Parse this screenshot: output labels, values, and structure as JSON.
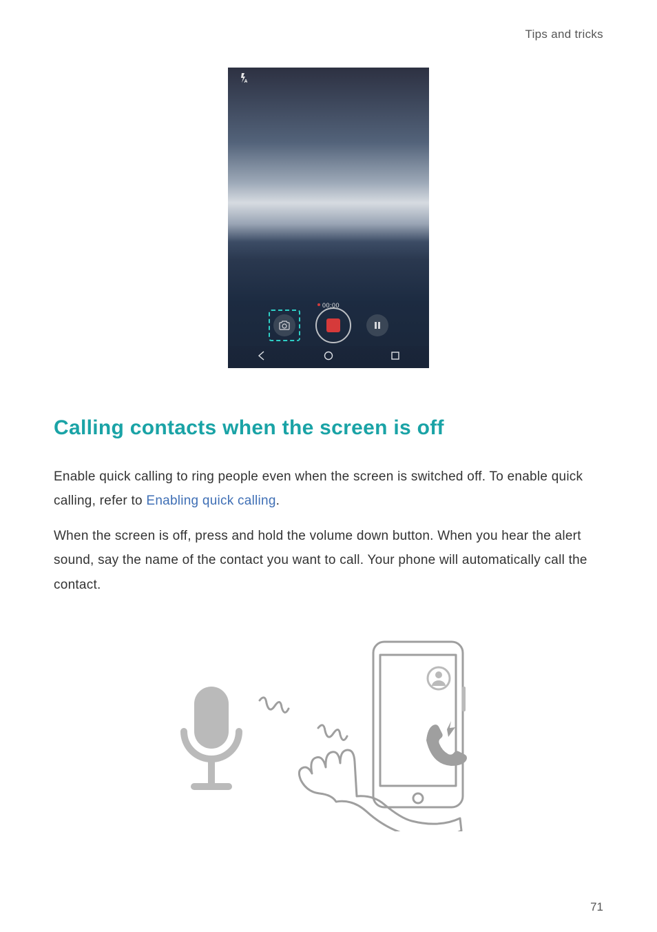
{
  "header": {
    "section_label": "Tips and tricks"
  },
  "screenshot": {
    "flash_icon_name": "flash-auto-icon",
    "recording_time": "00:00",
    "controls": {
      "camera_icon_name": "camera-icon",
      "record_icon_name": "record-button",
      "pause_icon_name": "pause-icon"
    },
    "nav": {
      "back_icon": "nav-back-icon",
      "home_icon": "nav-home-icon",
      "recents_icon": "nav-recents-icon"
    }
  },
  "section": {
    "title": "Calling contacts when the screen is off",
    "para1_a": "Enable quick calling to ring people even when the screen is switched off. To enable quick calling, refer to ",
    "para1_link": "Enabling quick calling",
    "para1_b": ".",
    "para2": "When the screen is off, press and hold the volume down button. When you hear the alert sound, say the name of the contact you want to call. Your phone will automatically call the contact."
  },
  "illustration": {
    "mic_icon_name": "microphone-icon",
    "phone_icon_name": "phone-outline-icon",
    "avatar_icon_name": "avatar-icon",
    "call_icon_name": "quick-call-icon"
  },
  "page_number": "71",
  "colors": {
    "accent": "#1aa3a6",
    "link": "#3f6fb5"
  }
}
